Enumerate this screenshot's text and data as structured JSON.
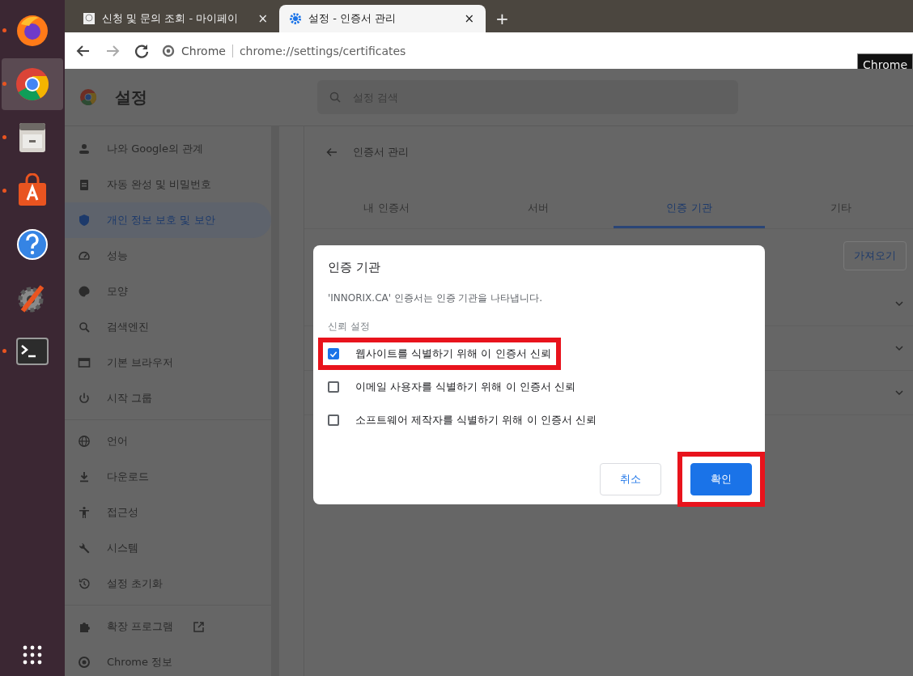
{
  "dock": {
    "items": [
      {
        "kind": "firefox",
        "running": true,
        "selected": false
      },
      {
        "kind": "chrome",
        "running": true,
        "selected": true
      },
      {
        "kind": "files",
        "running": true,
        "selected": false
      },
      {
        "kind": "store",
        "running": true,
        "selected": false
      },
      {
        "kind": "help",
        "running": false,
        "selected": false
      },
      {
        "kind": "settings",
        "running": false,
        "selected": false
      },
      {
        "kind": "terminal",
        "running": true,
        "selected": false
      }
    ]
  },
  "tabs": [
    {
      "title": "신청 및 문의 조회 - 마이페이",
      "close": "×",
      "selected": false
    },
    {
      "title": "설정 - 인증서 관리",
      "close": "×",
      "selected": true
    }
  ],
  "new_tab": "+",
  "address_bar": {
    "site": "Chrome",
    "url": "chrome://settings/certificates"
  },
  "tooltip": "Chrome",
  "settings_header": {
    "title": "설정",
    "search": {
      "placeholder": "설정 검색"
    }
  },
  "sidebar": {
    "sections": [
      [
        {
          "label": "나와 Google의 관계",
          "selected": false
        },
        {
          "label": "자동 완성 및 비밀번호",
          "selected": false
        },
        {
          "label": "개인 정보 보호 및 보안",
          "selected": true
        },
        {
          "label": "성능",
          "selected": false
        },
        {
          "label": "모양",
          "selected": false
        },
        {
          "label": "검색엔진",
          "selected": false
        },
        {
          "label": "기본 브라우저",
          "selected": false
        },
        {
          "label": "시작 그룹",
          "selected": false
        }
      ],
      [
        {
          "label": "언어",
          "selected": false
        },
        {
          "label": "다운로드",
          "selected": false
        },
        {
          "label": "접근성",
          "selected": false
        },
        {
          "label": "시스템",
          "selected": false
        },
        {
          "label": "설정 초기화",
          "selected": false
        }
      ],
      [
        {
          "label": "확장 프로그램",
          "selected": false,
          "external": true
        },
        {
          "label": "Chrome 정보",
          "selected": false,
          "external": false
        }
      ]
    ]
  },
  "page": {
    "title": "인증서 관리",
    "tabs": [
      {
        "label": "내 인증서",
        "selected": false
      },
      {
        "label": "서버",
        "selected": false
      },
      {
        "label": "인증 기관",
        "selected": true
      },
      {
        "label": "기타",
        "selected": false
      }
    ],
    "import_button": "가져오기",
    "expandable_rows": [
      {
        "expanded": false
      },
      {
        "expanded": false
      },
      {
        "expanded": false
      }
    ]
  },
  "dialog": {
    "title": "인증 기관",
    "description": "'INNORIX.CA' 인증서는 인증 기관을 나타냅니다.",
    "section_label": "신뢰 설정",
    "options": [
      {
        "label": "웹사이트를 식별하기 위해 이 인증서 신뢰",
        "checked": true,
        "highlighted": true
      },
      {
        "label": "이메일 사용자를 식별하기 위해 이 인증서 신뢰",
        "checked": false,
        "highlighted": false
      },
      {
        "label": "소프트웨어 제작자를 식별하기 위해 이 인증서 신뢰",
        "checked": false,
        "highlighted": false
      }
    ],
    "buttons": [
      {
        "label": "취소",
        "kind": "secondary",
        "highlighted": false
      },
      {
        "label": "확인",
        "kind": "primary",
        "highlighted": true
      }
    ]
  }
}
